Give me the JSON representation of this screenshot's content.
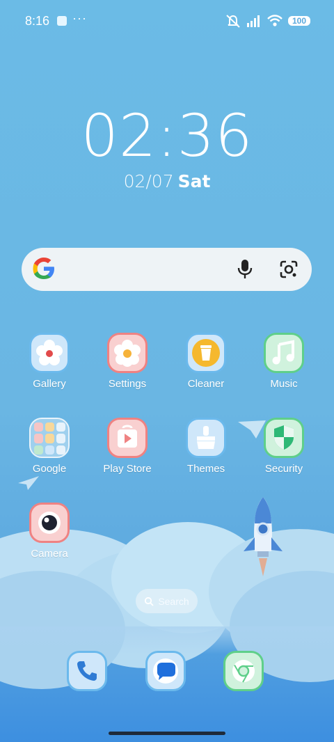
{
  "status_bar": {
    "time": "8:16",
    "more": "···",
    "battery": "100"
  },
  "clock": {
    "time": "02:36",
    "date": "02/07",
    "weekday": "Sat"
  },
  "search_widget": {
    "placeholder": ""
  },
  "apps": [
    {
      "label": "Gallery"
    },
    {
      "label": "Settings"
    },
    {
      "label": "Cleaner"
    },
    {
      "label": "Music"
    },
    {
      "label": "Google"
    },
    {
      "label": "Play Store"
    },
    {
      "label": "Themes"
    },
    {
      "label": "Security"
    },
    {
      "label": "Camera"
    }
  ],
  "search_pill": {
    "label": "Search"
  },
  "dock": [
    {
      "name": "phone-icon"
    },
    {
      "name": "messages-icon"
    },
    {
      "name": "chrome-icon"
    }
  ]
}
